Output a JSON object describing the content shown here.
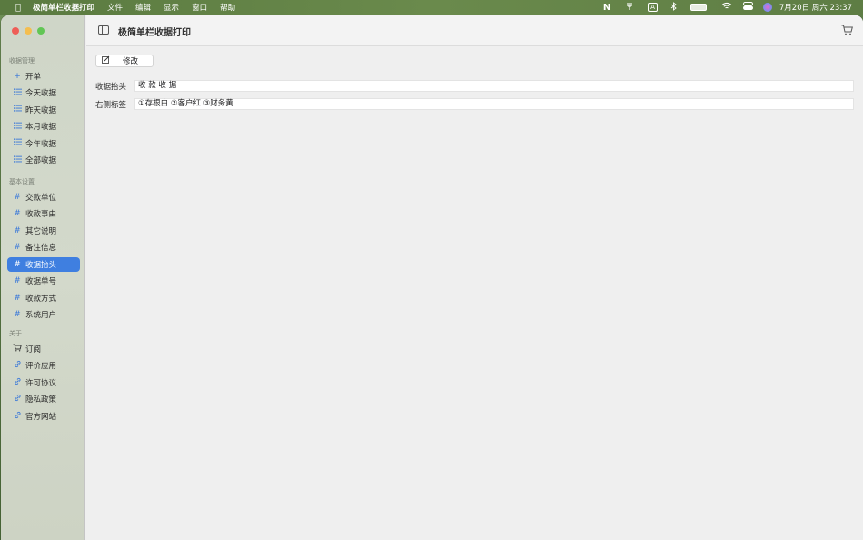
{
  "menubar": {
    "app_name": "极简单栏收据打印",
    "menus": [
      "文件",
      "编辑",
      "显示",
      "窗口",
      "帮助"
    ],
    "status_n": "N",
    "status_input": "A",
    "datetime": "7月20日 周六 23:37"
  },
  "window": {
    "title": "极简单栏收据打印"
  },
  "sidebar": {
    "sections": [
      {
        "title": "收据管理",
        "items": [
          {
            "label": "开单",
            "icon": "plus-icon"
          },
          {
            "label": "今天收据",
            "icon": "list-icon"
          },
          {
            "label": "昨天收据",
            "icon": "list-icon"
          },
          {
            "label": "本月收据",
            "icon": "list-icon"
          },
          {
            "label": "今年收据",
            "icon": "list-icon"
          },
          {
            "label": "全部收据",
            "icon": "list-icon"
          }
        ]
      },
      {
        "title": "基本设置",
        "items": [
          {
            "label": "交款单位",
            "icon": "hash-icon"
          },
          {
            "label": "收款事由",
            "icon": "hash-icon"
          },
          {
            "label": "其它说明",
            "icon": "hash-icon"
          },
          {
            "label": "备注信息",
            "icon": "hash-icon"
          },
          {
            "label": "收据抬头",
            "icon": "hash-icon",
            "selected": true
          },
          {
            "label": "收据单号",
            "icon": "hash-icon"
          },
          {
            "label": "收款方式",
            "icon": "hash-icon"
          },
          {
            "label": "系统用户",
            "icon": "hash-icon"
          }
        ]
      },
      {
        "title": "关于",
        "items": [
          {
            "label": "订阅",
            "icon": "cart-icon"
          },
          {
            "label": "评价应用",
            "icon": "link-icon"
          },
          {
            "label": "许可协议",
            "icon": "link-icon"
          },
          {
            "label": "隐私政策",
            "icon": "link-icon"
          },
          {
            "label": "官方网站",
            "icon": "link-icon"
          }
        ]
      }
    ]
  },
  "main": {
    "edit_button_label": "修改",
    "fields": [
      {
        "label": "收据抬头",
        "value": "收 款 收 据"
      },
      {
        "label": "右侧标签",
        "value": "①存根白 ②客户红 ③财务黄"
      }
    ]
  },
  "colors": {
    "selection": "#3f7fe0",
    "icon_accent": "#3a78d8"
  }
}
